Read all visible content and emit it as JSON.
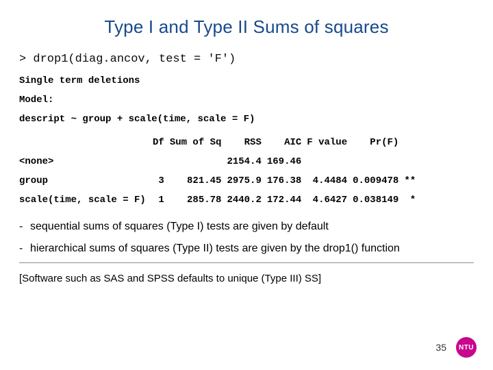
{
  "title": "Type I and Type II Sums of squares",
  "code_cmd": "> drop1(diag.ancov, test = 'F')",
  "output": {
    "single_term": "Single term deletions",
    "model_label": "Model:",
    "model_formula": "descript ~ group + scale(time, scale = F)"
  },
  "anova": {
    "headers": [
      "",
      "Df",
      "Sum of Sq",
      "RSS",
      "AIC",
      "F value",
      "Pr(F)",
      ""
    ],
    "rows": [
      {
        "label": "<none>",
        "cells": [
          "",
          "",
          "2154.4",
          "169.46",
          "",
          "",
          ""
        ]
      },
      {
        "label": "group",
        "cells": [
          "3",
          "821.45",
          "2975.9",
          "176.38",
          "4.4484",
          "0.009478",
          "**"
        ]
      },
      {
        "label": "scale(time, scale = F)",
        "cells": [
          "1",
          "285.78",
          "2440.2",
          "172.44",
          "4.6427",
          "0.038149",
          "*"
        ]
      }
    ]
  },
  "bullets": [
    "sequential sums of squares (Type I) tests are given by default",
    "hierarchical sums of squares (Type II) tests are given by the drop1() function"
  ],
  "footnote": "[Software such as SAS and SPSS defaults to unique (Type III) SS]",
  "page_number": "35",
  "badge": "NTU"
}
